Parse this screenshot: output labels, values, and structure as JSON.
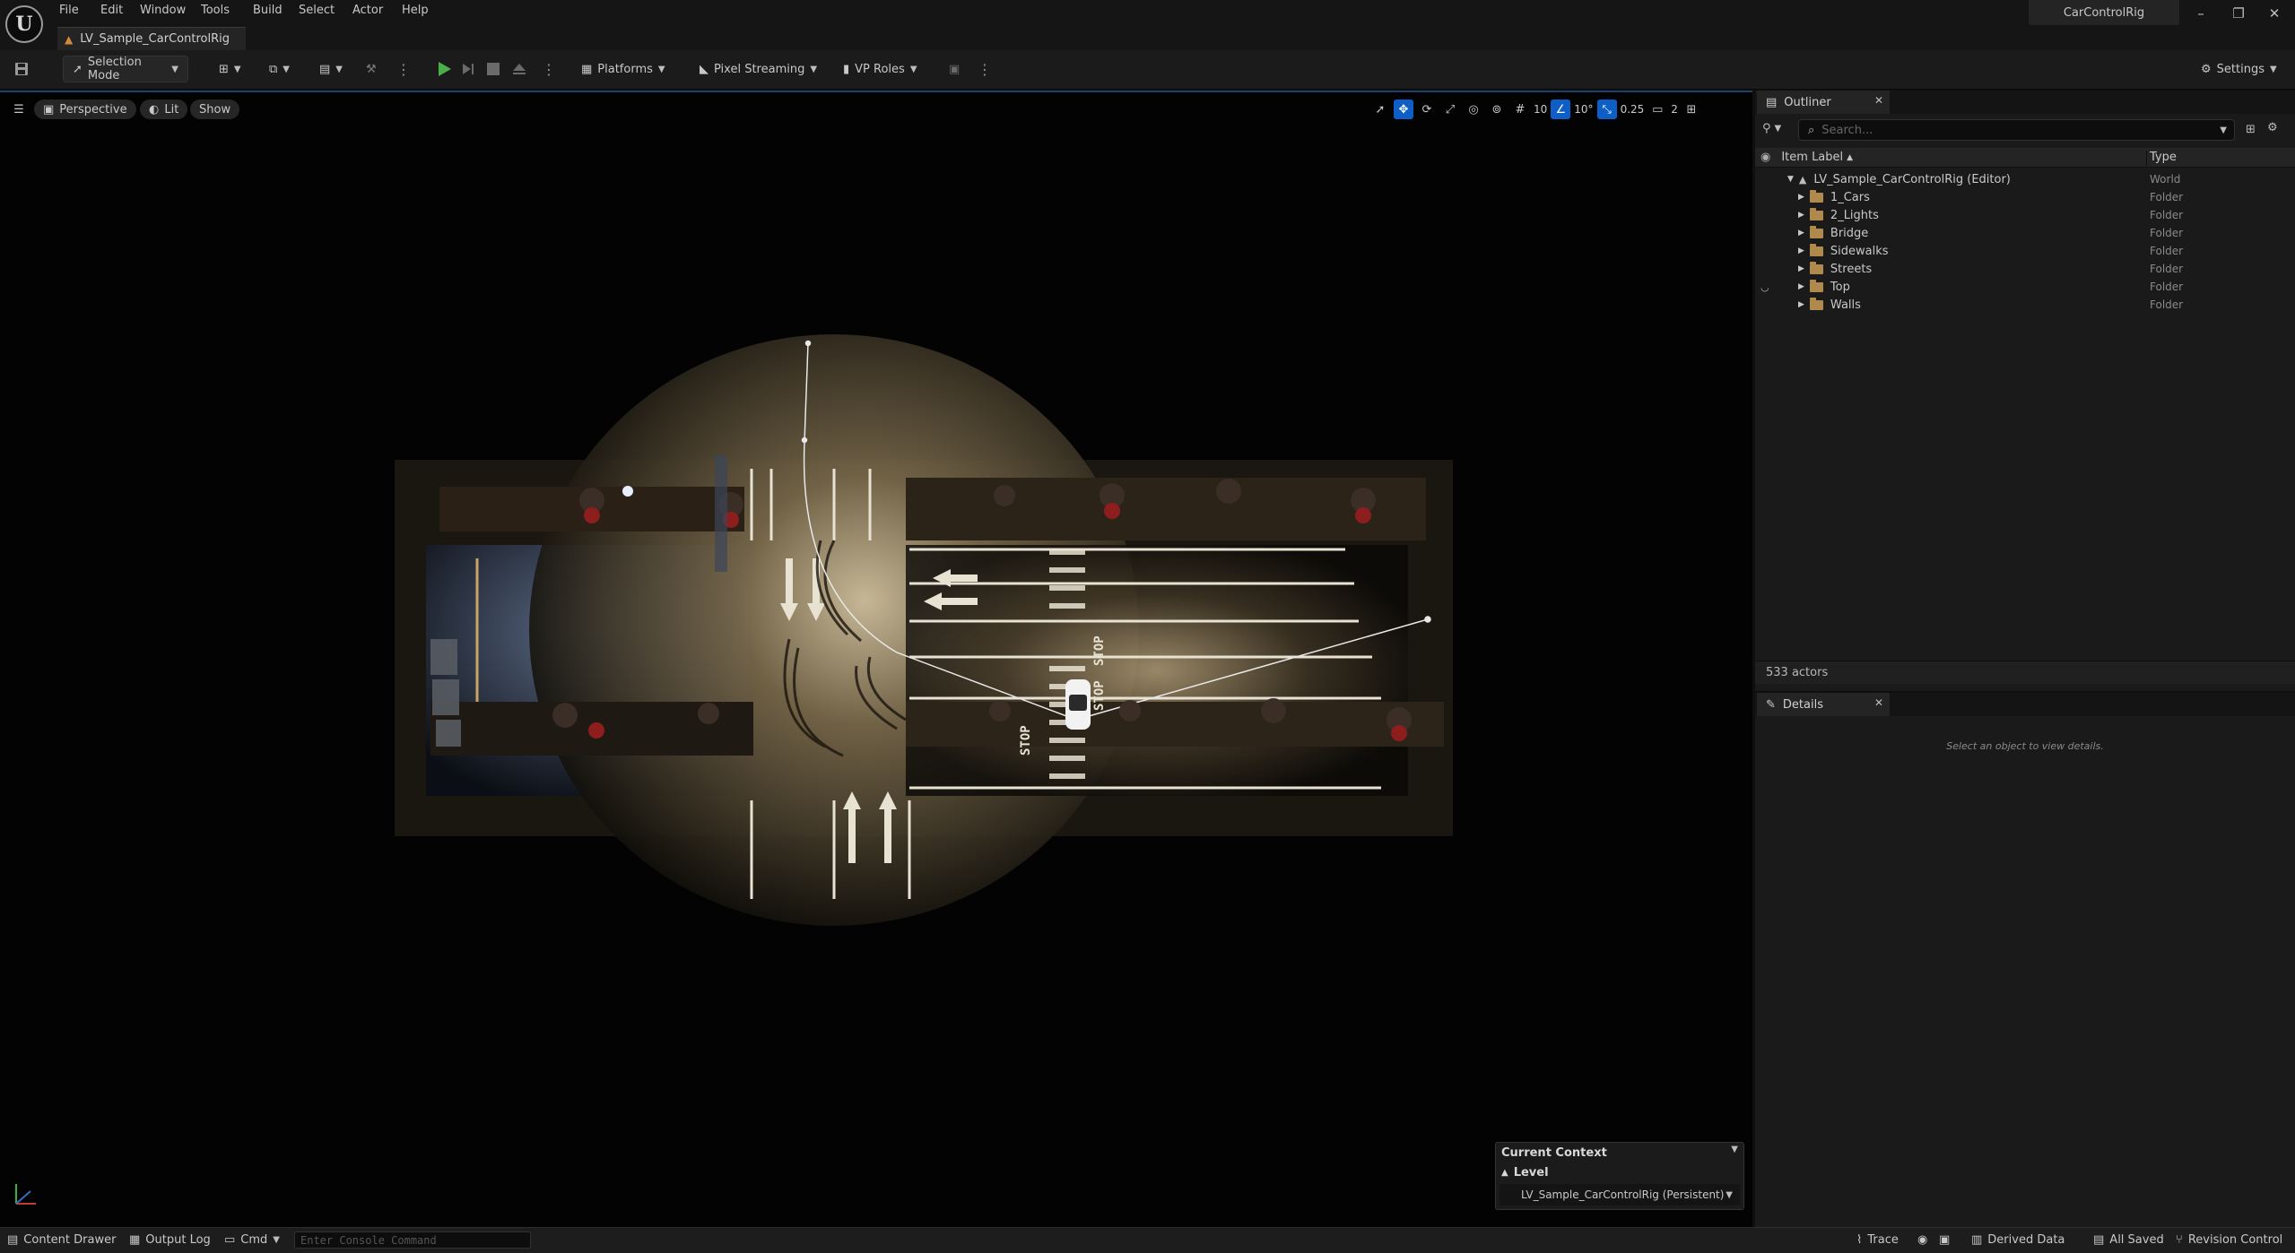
{
  "window": {
    "project_name": "CarControlRig",
    "doc_tab": "LV_Sample_CarControlRig",
    "minimize": "–",
    "restore": "❐",
    "close": "✕"
  },
  "menu": [
    "File",
    "Edit",
    "Window",
    "Tools",
    "Build",
    "Select",
    "Actor",
    "Help"
  ],
  "toolbar": {
    "selection_mode": "Selection Mode",
    "platforms": "Platforms",
    "pixel_streaming": "Pixel Streaming",
    "vp_roles": "VP Roles",
    "settings": "Settings"
  },
  "viewport": {
    "perspective": "Perspective",
    "lit": "Lit",
    "show": "Show",
    "grid_snap": "10",
    "rotation_snap": "10°",
    "scale_snap": "0.25",
    "camera_speed": "2"
  },
  "outliner": {
    "tab": "Outliner",
    "search_placeholder": "Search...",
    "col_label": "Item Label",
    "col_type": "Type",
    "world": {
      "label": "LV_Sample_CarControlRig (Editor)",
      "type": "World"
    },
    "folders": [
      {
        "label": "1_Cars",
        "type": "Folder"
      },
      {
        "label": "2_Lights",
        "type": "Folder"
      },
      {
        "label": "Bridge",
        "type": "Folder"
      },
      {
        "label": "Sidewalks",
        "type": "Folder"
      },
      {
        "label": "Streets",
        "type": "Folder"
      },
      {
        "label": "Top",
        "type": "Folder"
      },
      {
        "label": "Walls",
        "type": "Folder"
      }
    ],
    "actor_count": "533 actors"
  },
  "details": {
    "tab": "Details",
    "empty_text": "Select an object to view details."
  },
  "context": {
    "title": "Current Context",
    "level_label": "Level",
    "level_value": "LV_Sample_CarControlRig (Persistent)"
  },
  "statusbar": {
    "content_drawer": "Content Drawer",
    "output_log": "Output Log",
    "cmd": "Cmd",
    "console_placeholder": "Enter Console Command",
    "trace": "Trace",
    "derived_data": "Derived Data",
    "all_saved": "All Saved",
    "revision_control": "Revision Control"
  },
  "road_markings": [
    "STOP",
    "STOP",
    "STOP"
  ],
  "colors": {
    "accent": "#0e5ec8",
    "play": "#49b048",
    "folder": "#b08a4c"
  }
}
